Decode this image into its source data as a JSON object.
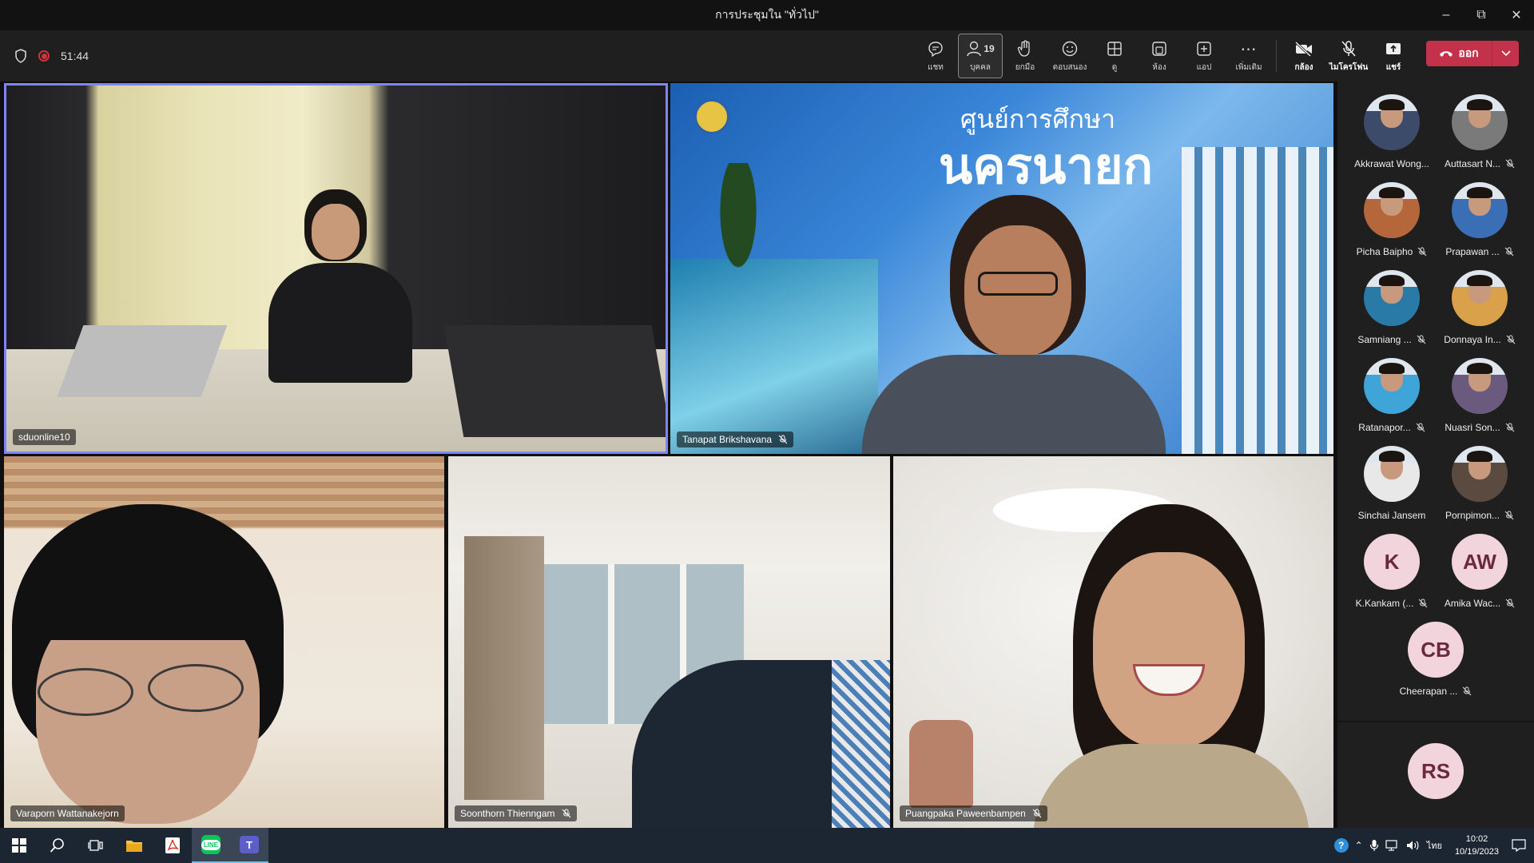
{
  "window": {
    "title": "การประชุมใน \"ทั่วไป\"",
    "controls": [
      "minimize",
      "restore",
      "close"
    ]
  },
  "toolbar": {
    "timer": "51:44",
    "tools": [
      {
        "name": "chat",
        "label": "แชท"
      },
      {
        "name": "people",
        "label": "บุคคล",
        "count": "19",
        "active": true
      },
      {
        "name": "raise-hand",
        "label": "ยกมือ"
      },
      {
        "name": "react",
        "label": "ตอบสนอง"
      },
      {
        "name": "view",
        "label": "ดู"
      },
      {
        "name": "rooms",
        "label": "ห้อง"
      },
      {
        "name": "apps",
        "label": "แอป"
      },
      {
        "name": "more",
        "label": "เพิ่มเติม"
      }
    ],
    "camera_label": "กล้อง",
    "mic_label": "ไมโครโฟน",
    "share_label": "แชร์",
    "leave_label": "ออก"
  },
  "tiles": [
    {
      "id": "t1",
      "name": "sduonline10",
      "muted": false,
      "active": true
    },
    {
      "id": "t2",
      "name": "Tanapat Brikshavana",
      "muted": true,
      "bg_title_top": "ศูนย์การศึกษา",
      "bg_title_big": "นครนายก"
    },
    {
      "id": "t3",
      "name": "Varaporn Wattanakejorn",
      "muted": false
    },
    {
      "id": "t4",
      "name": "Soonthorn Thienngam",
      "muted": true
    },
    {
      "id": "t5",
      "name": "Puangpaka Paweenbampen",
      "muted": true
    }
  ],
  "roster": [
    {
      "name": "Akkrawat Wong...",
      "muted": false,
      "photo": true,
      "tone": "#3d4b6a"
    },
    {
      "name": "Auttasart N...",
      "muted": true,
      "photo": true,
      "tone": "#7a7a7a"
    },
    {
      "name": "Picha Baipho",
      "muted": true,
      "photo": true,
      "tone": "#b5663b"
    },
    {
      "name": "Prapawan ...",
      "muted": true,
      "photo": true,
      "tone": "#3b6fb5"
    },
    {
      "name": "Samniang ...",
      "muted": true,
      "photo": true,
      "tone": "#2a7aa8"
    },
    {
      "name": "Donnaya In...",
      "muted": true,
      "photo": true,
      "tone": "#d9a14a"
    },
    {
      "name": "Ratanapor...",
      "muted": true,
      "photo": true,
      "tone": "#3fa5d8"
    },
    {
      "name": "Nuasri Son...",
      "muted": true,
      "photo": true,
      "tone": "#6a5a7e"
    },
    {
      "name": "Sinchai Jansem",
      "muted": false,
      "photo": true,
      "tone": "#e8e8e8"
    },
    {
      "name": "Pornpimon...",
      "muted": true,
      "photo": true,
      "tone": "#5a4a40"
    },
    {
      "name": "K.Kankam (...",
      "muted": true,
      "initials": "K"
    },
    {
      "name": "Amika Wac...",
      "muted": true,
      "initials": "AW"
    },
    {
      "name": "Cheerapan ...",
      "muted": true,
      "initials": "CB"
    },
    {
      "name": "",
      "muted": false,
      "initials": "RS"
    }
  ],
  "taskbar": {
    "time": "10:02",
    "date": "10/19/2023",
    "lang": "ไทย"
  },
  "colors": {
    "accent": "#7f85f5",
    "leave": "#c4314b",
    "avatar_bg": "#f2d5dc"
  }
}
